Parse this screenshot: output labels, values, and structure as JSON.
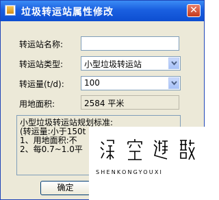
{
  "window": {
    "title": "垃圾转运站属性修改",
    "close_glyph": "✕"
  },
  "form": {
    "name_label": "转运站名称:",
    "name_value": "",
    "type_label": "转运站类型:",
    "type_value": "小型垃圾转运站",
    "volume_label": "转运量(t/d):",
    "volume_value": "100",
    "area_label": "用地面积:",
    "area_value": "2584 平米"
  },
  "standard": {
    "lines": [
      "小型垃圾转运站规划标准:",
      "(转运量:小于150t",
      "  1、用地面积:不",
      "  2、每0.7~1.0平"
    ]
  },
  "buttons": {
    "ok_label": "确定",
    "cancel_label": ""
  },
  "watermark": {
    "text": "SHENKONGYOUXI",
    "seal_glyphs": [
      "深",
      "空",
      "遊",
      "戲"
    ]
  },
  "colors": {
    "titlebar": "#0d4ed1",
    "window_bg": "#ece9d8",
    "close_button": "#c5391c"
  },
  "icons": {
    "app": "app-icon",
    "close": "close-icon",
    "dropdown": "chevron-down-icon"
  }
}
